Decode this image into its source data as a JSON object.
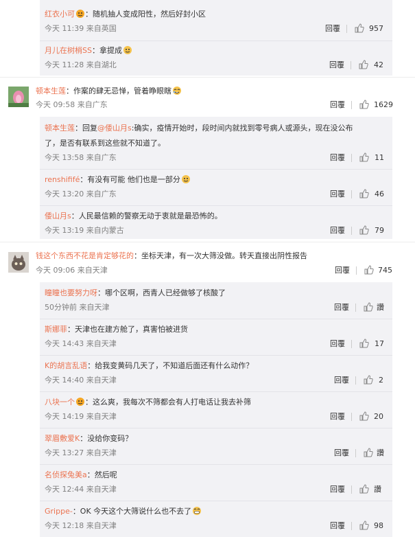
{
  "comments": [
    {
      "user": "红衣小可",
      "text": "：随机抽人变成阳性，然后好封小区",
      "time": "今天 11:39 来自英国",
      "reply": "回覆",
      "likes": "957"
    },
    {
      "user": "月儿在树梢SS",
      "text": "：拿提成",
      "time": "今天 11:28 来自湖北",
      "reply": "回覆",
      "likes": "42"
    },
    {
      "user": "顿本生莲",
      "text": "：作案的肆无忌惮，管着睁眼瞎",
      "time": "今天 09:58 来自广东",
      "reply": "回覆",
      "likes": "1629"
    },
    {
      "user": "顿本生莲",
      "text1": "：回复",
      "mention": "@倭山月s",
      "text2": ":确实，疫情开始时，段时间内就找到零号病人或源头，现在没公布",
      "text3": "了，是否有联系到这些就不知道了。",
      "time": "今天 13:58 来自广东",
      "reply": "回覆",
      "likes": "11"
    },
    {
      "user": "renshififé",
      "text": "：有没有可能 他们也是一部分",
      "time": "今天 13:20 来自广东",
      "reply": "回覆",
      "likes": "46"
    },
    {
      "user": "倭山月s",
      "text": "：人民最信赖的警察无动于衷就是最恐怖的。",
      "time": "今天 13:19 来自内蒙古",
      "reply": "回覆",
      "likes": "79"
    },
    {
      "user": "钱这个东西不花是肯定够花的",
      "text": "：坐标天津，有一次大筛没做。转天直接出阴性报告",
      "time": "今天 09:06 来自天津",
      "reply": "回覆",
      "likes": "745"
    },
    {
      "user": "瞳瞳也要努力呀",
      "text": "：哪个区啊，西青人已经做够了核酸了",
      "time": "50分钟前 来自天津",
      "reply": "回覆",
      "likes": "讚"
    },
    {
      "user": "斯娜菲",
      "text": "：天津也在建方舱了，真害怕被进货",
      "time": "今天 14:43 来自天津",
      "reply": "回覆",
      "likes": "17"
    },
    {
      "user": "K的胡言乱语",
      "text": "：给我变黄码几天了，不知道后面还有什么动作？",
      "time": "今天 14:40 来自天津",
      "reply": "回覆",
      "likes": "2"
    },
    {
      "user": "八块一个",
      "text": "：这么爽，我每次不筛都会有人打电话让我去补筛",
      "time": "今天 14:19 来自天津",
      "reply": "回覆",
      "likes": "20"
    },
    {
      "user": "翠眉敷爱K",
      "text": "：没给你变码？",
      "time": "今天 13:27 来自天津",
      "reply": "回覆",
      "likes": "讚"
    },
    {
      "user": "名侦探兔美a",
      "text": "：然后呢",
      "time": "今天 12:44 来自天津",
      "reply": "回覆",
      "likes": "讚"
    },
    {
      "user": "Grippe-",
      "text": "：OK 今天这个大筛说什么也不去了",
      "time": "今天 12:18 来自天津",
      "reply": "回覆",
      "likes": "98"
    }
  ],
  "icons": {
    "like": "thumbs-up-icon",
    "avatar1": "lotus-avatar",
    "avatar2": "cat-avatar",
    "emoji": "emoji-icon"
  },
  "colors": {
    "username": "#eb7350",
    "meta": "#808080",
    "subBg": "#f2f2f5",
    "accentLike": "#808080"
  }
}
